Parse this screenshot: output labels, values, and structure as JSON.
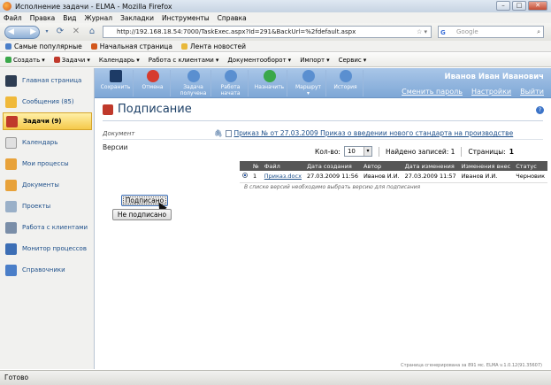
{
  "browser": {
    "title": "Исполнение задачи - ELMA - Mozilla Firefox",
    "menu": [
      "Файл",
      "Правка",
      "Вид",
      "Журнал",
      "Закладки",
      "Инструменты",
      "Справка"
    ],
    "address": "http://192.168.18.54:7000/TaskExec.aspx?Id=291&BackUrl=%2fdefault.aspx",
    "search_placeholder": "Google",
    "bookmarks": [
      "Самые популярные",
      "Начальная страница",
      "Лента новостей"
    ],
    "status": "Готово"
  },
  "toolbar2": [
    "Создать",
    "Задачи",
    "Календарь",
    "Работа с клиентами",
    "Документооборот",
    "Импорт",
    "Сервис"
  ],
  "sidebar": {
    "items": [
      {
        "label": "Главная страница",
        "color": "#2e3d52"
      },
      {
        "label": "Сообщения (85)",
        "color": "#f0b93a"
      },
      {
        "label": "Задачи (9)",
        "color": "#c0392b"
      },
      {
        "label": "Календарь",
        "color": "#e0e0e0"
      },
      {
        "label": "Мои процессы",
        "color": "#e8a23a"
      },
      {
        "label": "Документы",
        "color": "#e8a23a"
      },
      {
        "label": "Проекты",
        "color": "#9ab0c8"
      },
      {
        "label": "Работа с клиентами",
        "color": "#7a8ea8"
      },
      {
        "label": "Монитор процессов",
        "color": "#3c6eb5"
      },
      {
        "label": "Справочники",
        "color": "#4a7ec8"
      }
    ]
  },
  "header": {
    "actions": [
      {
        "label": "Сохранить",
        "color": "#1d3b66"
      },
      {
        "label": "Отмена",
        "color": "#d63b2e"
      },
      {
        "label": "Задача получена",
        "color": "#5a8fd0"
      },
      {
        "label": "Работа начата",
        "color": "#5a8fd0"
      },
      {
        "label": "Назначить",
        "color": "#3aa84a"
      },
      {
        "label": "Маршрут",
        "color": "#5a8fd0"
      },
      {
        "label": "История",
        "color": "#5a8fd0"
      }
    ],
    "user": "Иванов Иван Иванович",
    "links": [
      "Сменить пароль",
      "Настройки",
      "Выйти"
    ]
  },
  "page": {
    "title": "Подписание",
    "document_label": "Документ",
    "document_link": "Приказ № от 27.03.2009 Приказ о введении нового стандарта на производстве",
    "versions_label": "Версии",
    "count_label": "Кол-во:",
    "count_value": "10",
    "found_label": "Найдено записей: 1",
    "pages_label": "Страницы:",
    "pages_value": "1",
    "table": {
      "headers": [
        "№",
        "Файл",
        "Дата создания",
        "Автор",
        "Дата изменения",
        "Изменения внес",
        "Статус"
      ],
      "rows": [
        [
          "1",
          "Приказ.docx",
          "27.03.2009 11:56",
          "Иванов И.И.",
          "27.03.2009 11:57",
          "Иванов И.И.",
          "Черновик"
        ]
      ]
    },
    "note": "В списке версий необходимо выбрать версию для подписания",
    "sign_button": "Подписано",
    "unsign_button": "Не подписано",
    "footer": "Страница сгенерирована за 891 мс. ELMA v.1.0.12(91.35607)"
  }
}
